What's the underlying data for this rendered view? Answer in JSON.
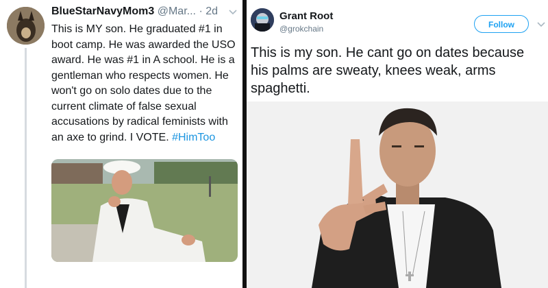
{
  "left_tweet": {
    "display_name": "BlueStarNavyMom3",
    "handle": "@Mar...",
    "separator": "·",
    "time": "2d",
    "text_before_hashtag": "This is MY son. He graduated #1 in boot camp. He was awarded the USO award. He was #1 in A school. He is a gentleman who respects women. He won't go on solo dates due to the current climate of false sexual accusations by radical feminists with an axe to grind. I VOTE.",
    "hashtag": "#HimToo",
    "icons": {
      "avatar": "dog-avatar",
      "menu": "chevron-down-icon",
      "photo": "sailor-photo"
    },
    "colors": {
      "hashtag": "#1b95e0"
    }
  },
  "right_tweet": {
    "display_name": "Grant Root",
    "handle": "@grokchain",
    "follow_label": "Follow",
    "text": "This is my son. He cant go on dates because his palms are sweaty, knees weak, arms spaghetti.",
    "icons": {
      "avatar": "profile-avatar",
      "menu": "chevron-down-icon",
      "photo": "man-pointing-photo"
    },
    "colors": {
      "accent": "#1da1f2"
    }
  }
}
